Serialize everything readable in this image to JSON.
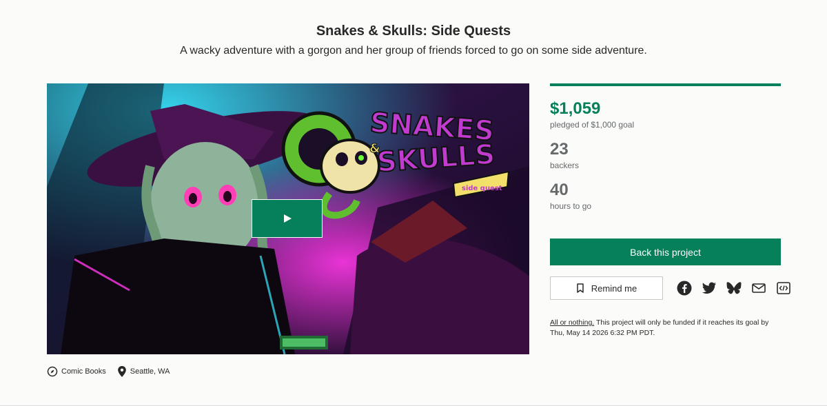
{
  "project": {
    "title": "Snakes & Skulls: Side Quests",
    "blurb": "A wacky adventure with a gorgon and her group of friends forced to go on some side adventure."
  },
  "media": {
    "logo_line1": "SNAKES",
    "logo_amp": "&",
    "logo_line2": "SKULLS",
    "logo_tag": "side quest",
    "play_icon": "play-icon"
  },
  "meta": {
    "category": "Comic Books",
    "category_icon": "compass-icon",
    "location": "Seattle, WA",
    "location_icon": "location-pin-icon"
  },
  "stats": {
    "funded_fraction": 1.0,
    "pledged": "$1,059",
    "pledged_label": "pledged of $1,000 goal",
    "backers": "23",
    "backers_label": "backers",
    "time_left": "40",
    "time_left_label": "hours to go"
  },
  "actions": {
    "back_label": "Back this project",
    "remind_label": "Remind me",
    "remind_icon": "bookmark-icon",
    "share_icons": [
      "facebook-icon",
      "twitter-icon",
      "bluesky-icon",
      "email-icon",
      "embed-icon"
    ]
  },
  "funding_note": {
    "link": "All or nothing.",
    "text": " This project will only be funded if it reaches its goal by Thu, May 14 2026 6:32 PM PDT."
  },
  "colors": {
    "accent": "#05805a",
    "muted": "#656969",
    "text": "#282828"
  }
}
